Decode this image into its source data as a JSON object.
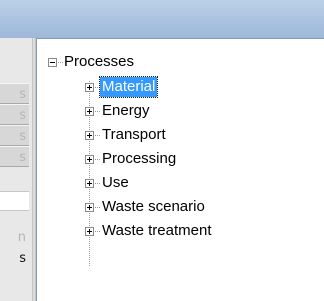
{
  "left_panel": {
    "items": [
      {
        "label": "s"
      },
      {
        "label": "s"
      },
      {
        "label": "s"
      },
      {
        "label": "s"
      },
      {
        "label": "n"
      },
      {
        "label": "s"
      }
    ]
  },
  "tree": {
    "root": {
      "label": "Processes",
      "expanded": true
    },
    "children": [
      {
        "label": "Material",
        "selected": true
      },
      {
        "label": "Energy"
      },
      {
        "label": "Transport"
      },
      {
        "label": "Processing"
      },
      {
        "label": "Use"
      },
      {
        "label": "Waste scenario"
      },
      {
        "label": "Waste treatment"
      }
    ]
  },
  "colors": {
    "selection": "#3399ff",
    "title_bar": "#a9c1df"
  },
  "icons": {
    "collapse": "minus-box-icon",
    "expand": "plus-box-icon"
  }
}
